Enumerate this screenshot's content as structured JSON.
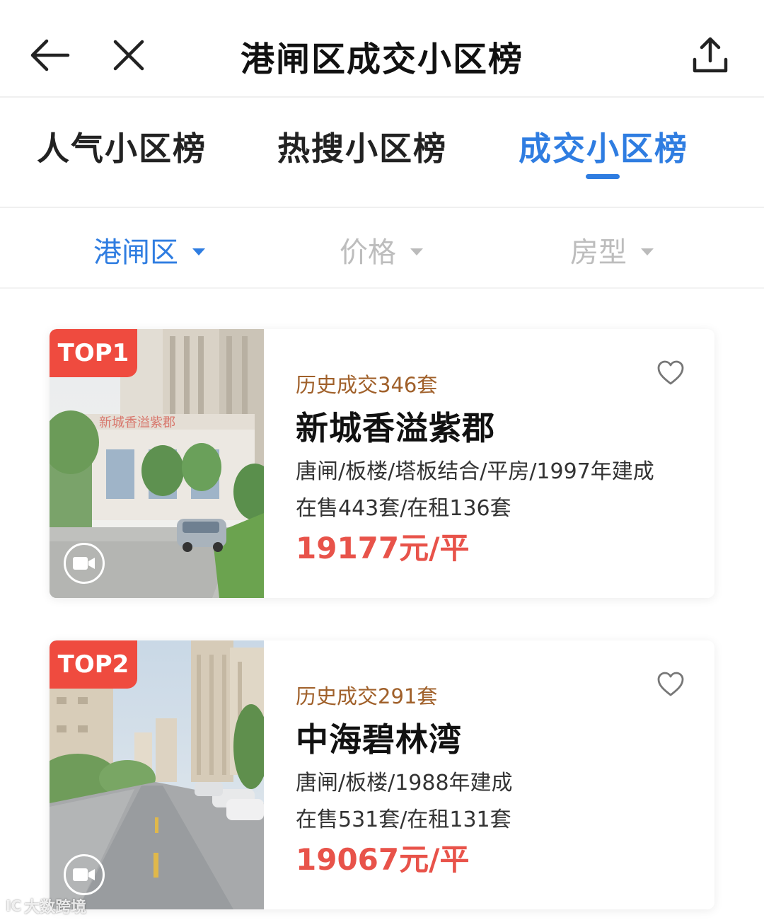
{
  "header": {
    "title": "港闸区成交小区榜",
    "back_icon": "back-arrow-icon",
    "close_icon": "close-icon",
    "share_icon": "share-upload-icon"
  },
  "tabs": [
    {
      "label": "人气小区榜",
      "active": false
    },
    {
      "label": "热搜小区榜",
      "active": false
    },
    {
      "label": "成交小区榜",
      "active": true
    }
  ],
  "filters": [
    {
      "label": "港闸区",
      "active": true
    },
    {
      "label": "价格",
      "active": false
    },
    {
      "label": "房型",
      "active": false
    }
  ],
  "listings": [
    {
      "rank": "TOP1",
      "deals": "历史成交346套",
      "name": "新城香溢紫郡",
      "attrs": "唐闸/板楼/塔板结合/平房/1997年建成",
      "stock": "在售443套/在租136套",
      "price": "19177元/平",
      "photo_sign": "新城香溢紫郡"
    },
    {
      "rank": "TOP2",
      "deals": "历史成交291套",
      "name": "中海碧林湾",
      "attrs": "唐闸/板楼/1988年建成",
      "stock": "在售531套/在租131套",
      "price": "19067元/平"
    }
  ],
  "watermark": {
    "logo": "IC",
    "text": "大数跨境"
  },
  "colors": {
    "accent": "#2f7de1",
    "badge": "#ef4b3f",
    "price": "#e8534a",
    "deals": "#a0602a"
  }
}
